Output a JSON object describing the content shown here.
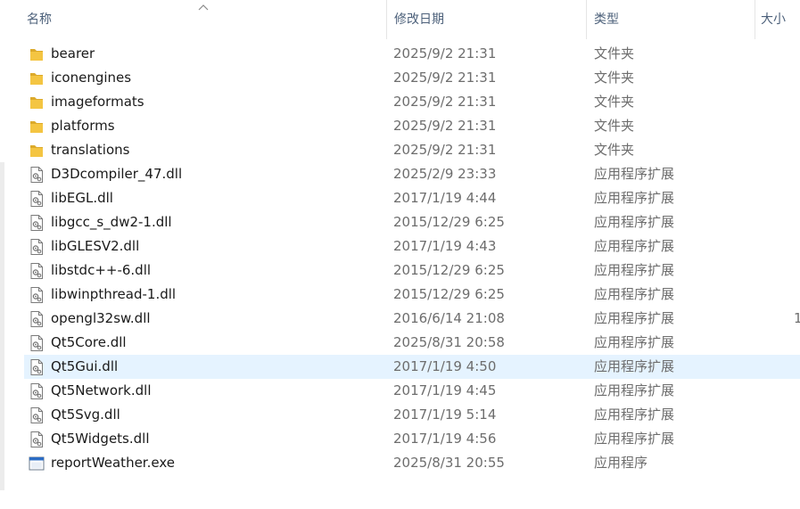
{
  "columns": {
    "name": "名称",
    "date": "修改日期",
    "type": "类型",
    "size": "大小"
  },
  "sort": {
    "column": "name",
    "direction": "ascending"
  },
  "selected_row": "Qt5Gui.dll",
  "colors": {
    "folder": "#f4c542",
    "selection": "#e5f3ff",
    "header_text": "#4c607a",
    "secondary_text": "#6d6d6d"
  },
  "files": [
    {
      "name": "bearer",
      "date": "2025/9/2 21:31",
      "type": "文件夹",
      "size": "",
      "icon": "folder-icon"
    },
    {
      "name": "iconengines",
      "date": "2025/9/2 21:31",
      "type": "文件夹",
      "size": "",
      "icon": "folder-icon"
    },
    {
      "name": "imageformats",
      "date": "2025/9/2 21:31",
      "type": "文件夹",
      "size": "",
      "icon": "folder-icon"
    },
    {
      "name": "platforms",
      "date": "2025/9/2 21:31",
      "type": "文件夹",
      "size": "",
      "icon": "folder-icon"
    },
    {
      "name": "translations",
      "date": "2025/9/2 21:31",
      "type": "文件夹",
      "size": "",
      "icon": "folder-icon"
    },
    {
      "name": "D3Dcompiler_47.dll",
      "date": "2025/2/9 23:33",
      "type": "应用程序扩展",
      "size": "",
      "icon": "dll-file-icon"
    },
    {
      "name": "libEGL.dll",
      "date": "2017/1/19 4:44",
      "type": "应用程序扩展",
      "size": "",
      "icon": "dll-file-icon"
    },
    {
      "name": "libgcc_s_dw2-1.dll",
      "date": "2015/12/29 6:25",
      "type": "应用程序扩展",
      "size": "",
      "icon": "dll-file-icon"
    },
    {
      "name": "libGLESV2.dll",
      "date": "2017/1/19 4:43",
      "type": "应用程序扩展",
      "size": "",
      "icon": "dll-file-icon"
    },
    {
      "name": "libstdc++-6.dll",
      "date": "2015/12/29 6:25",
      "type": "应用程序扩展",
      "size": "",
      "icon": "dll-file-icon"
    },
    {
      "name": "libwinpthread-1.dll",
      "date": "2015/12/29 6:25",
      "type": "应用程序扩展",
      "size": "",
      "icon": "dll-file-icon"
    },
    {
      "name": "opengl32sw.dll",
      "date": "2016/6/14 21:08",
      "type": "应用程序扩展",
      "size": "1",
      "icon": "dll-file-icon"
    },
    {
      "name": "Qt5Core.dll",
      "date": "2025/8/31 20:58",
      "type": "应用程序扩展",
      "size": "",
      "icon": "dll-file-icon"
    },
    {
      "name": "Qt5Gui.dll",
      "date": "2017/1/19 4:50",
      "type": "应用程序扩展",
      "size": "",
      "icon": "dll-file-icon"
    },
    {
      "name": "Qt5Network.dll",
      "date": "2017/1/19 4:45",
      "type": "应用程序扩展",
      "size": "",
      "icon": "dll-file-icon"
    },
    {
      "name": "Qt5Svg.dll",
      "date": "2017/1/19 5:14",
      "type": "应用程序扩展",
      "size": "",
      "icon": "dll-file-icon"
    },
    {
      "name": "Qt5Widgets.dll",
      "date": "2017/1/19 4:56",
      "type": "应用程序扩展",
      "size": "",
      "icon": "dll-file-icon"
    },
    {
      "name": "reportWeather.exe",
      "date": "2025/8/31 20:55",
      "type": "应用程序",
      "size": "",
      "icon": "exe-file-icon"
    }
  ]
}
